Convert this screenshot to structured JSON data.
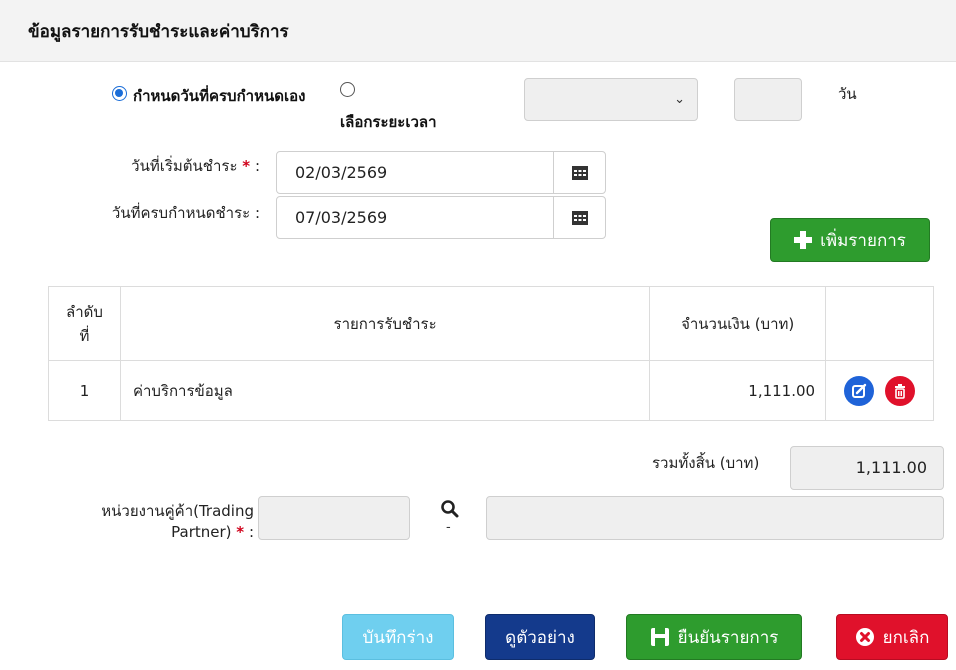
{
  "header": {
    "title": "ข้อมูลรายการรับชำระและค่าบริการ"
  },
  "due_mode": {
    "option_self": "กำหนดวันที่ครบกำหนดเอง",
    "option_period": "เลือกระยะเวลา",
    "selected": "option_self"
  },
  "period": {
    "select_value": "",
    "days_value": "",
    "days_unit": "วัน"
  },
  "dates": {
    "start_label": "วันที่เริ่มต้นชำระ",
    "start_required": "*",
    "start_value": "02/03/2569",
    "due_label": "วันที่ครบกำหนดชำระ :",
    "due_value": "07/03/2569",
    "colon": ":"
  },
  "actions": {
    "add_label": "เพิ่มรายการ"
  },
  "table": {
    "headers": {
      "no_line1": "ลำดับ",
      "no_line2": "ที่",
      "desc": "รายการรับชำระ",
      "amount": "จำนวนเงิน (บาท)"
    },
    "rows": [
      {
        "no": "1",
        "desc": "ค่าบริการข้อมูล",
        "amount": "1,111.00"
      }
    ]
  },
  "total": {
    "label": "รวมทั้งสิ้น (บาท)",
    "value": "1,111.00"
  },
  "trading_partner": {
    "label_line1": "หน่วยงานคู่ค้า(Trading",
    "label_line2": "Partner)",
    "required": "*",
    "colon": ":",
    "code_value": "",
    "name_value": "",
    "dash": "-"
  },
  "footer_buttons": {
    "draft": "บันทึกร่าง",
    "preview": "ดูตัวอย่าง",
    "confirm": "ยืนยันรายการ",
    "cancel": "ยกเลิก"
  },
  "colors": {
    "green": "#2e9c2e",
    "blue_dark": "#143a8c",
    "cyan": "#6fcfef",
    "red": "#e0112b",
    "radio_blue": "#1a6dd8"
  }
}
